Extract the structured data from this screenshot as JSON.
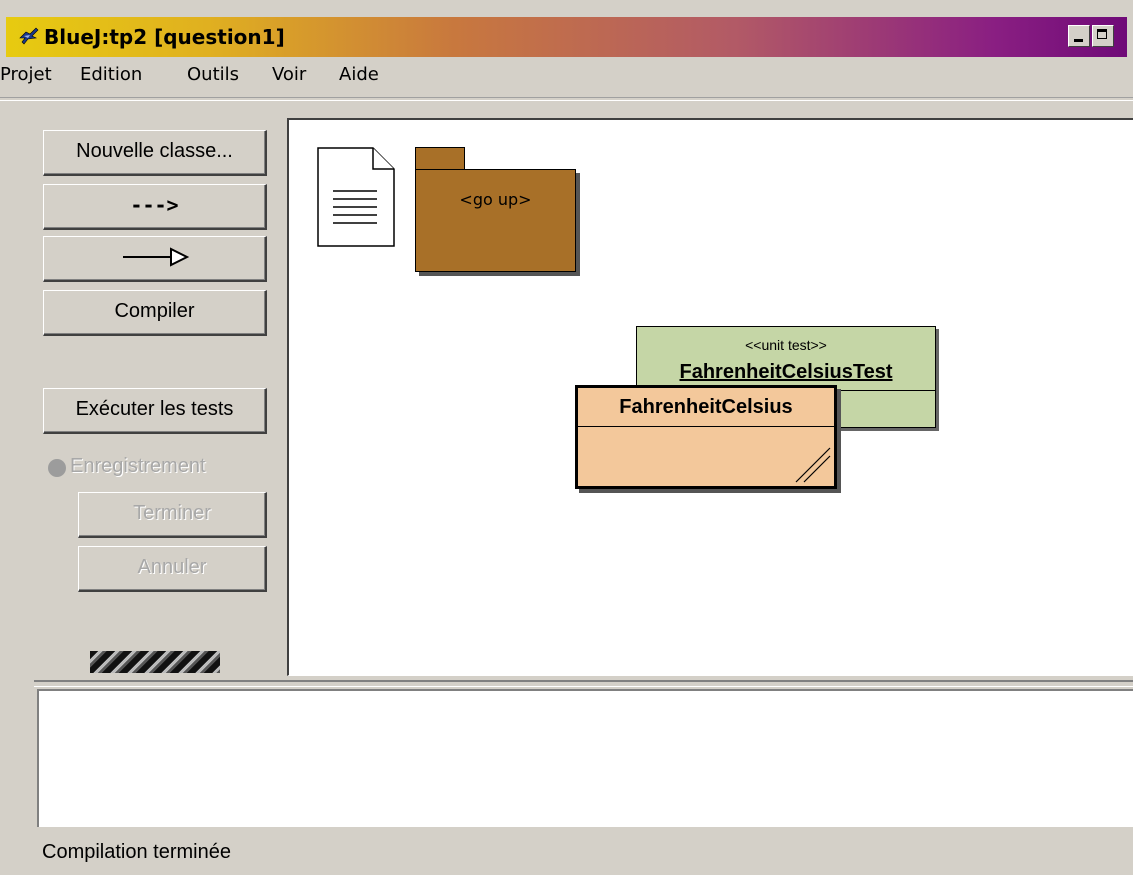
{
  "window": {
    "title": "BlueJ:tp2  [question1]",
    "title_gradient": [
      "#e7cb10",
      "#6f0a78"
    ]
  },
  "menu": [
    "Projet",
    "Edition",
    "Outils",
    "Voir",
    "Aide"
  ],
  "toolbar": {
    "new_class": "Nouvelle classe...",
    "dependency_arrow": "--->",
    "inheritance_arrow": "inheritance-arrow-icon",
    "compile": "Compiler"
  },
  "tests": {
    "run_tests": "Exécuter les tests",
    "recording": "Enregistrement",
    "end": "Terminer",
    "cancel": "Annuler"
  },
  "diagram": {
    "readme_icon": "document-icon",
    "go_up": "<go up>",
    "test_class_stereotype": "<<unit test>>",
    "test_class_name": "FahrenheitCelsiusTest",
    "main_class_name": "FahrenheitCelsius",
    "colors": {
      "package": "#a87028",
      "unit_test": "#c5d6a6",
      "class": "#f3c89b"
    }
  },
  "status": "Compilation terminée"
}
